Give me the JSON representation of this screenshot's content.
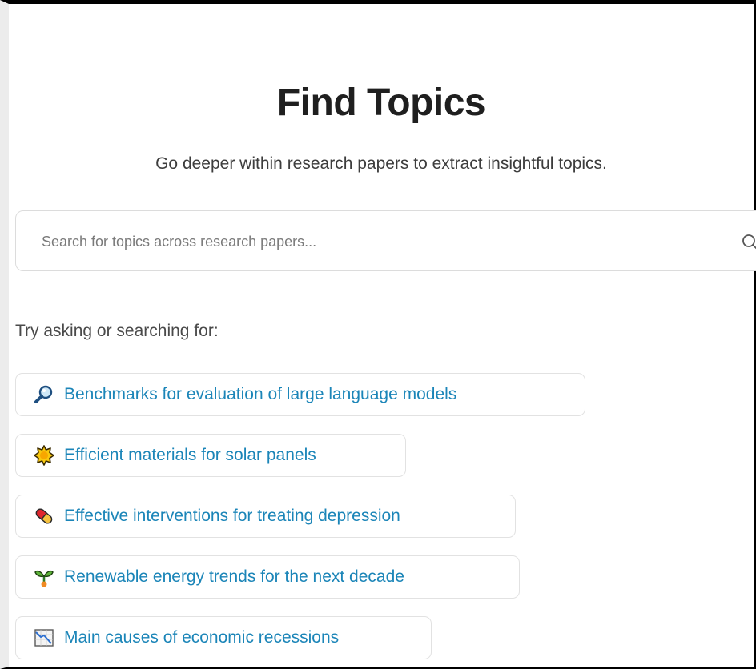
{
  "header": {
    "title": "Find Topics",
    "subtitle": "Go deeper within research papers to extract insightful topics."
  },
  "search": {
    "placeholder": "Search for topics across research papers...",
    "value": "",
    "icon": "search-icon"
  },
  "suggestions": {
    "heading": "Try asking or searching for:",
    "items": [
      {
        "label": "Benchmarks for evaluation of large language models",
        "icon": "magnifying-glass-icon"
      },
      {
        "label": "Efficient materials for solar panels",
        "icon": "sun-icon"
      },
      {
        "label": "Effective interventions for treating depression",
        "icon": "pill-icon"
      },
      {
        "label": "Renewable energy trends for the next decade",
        "icon": "seedling-icon"
      },
      {
        "label": "Main causes of economic recessions",
        "icon": "chart-decreasing-icon"
      }
    ]
  },
  "colors": {
    "link": "#1b85b8",
    "title": "#1f1f1f",
    "border": "#dcdcdc"
  }
}
